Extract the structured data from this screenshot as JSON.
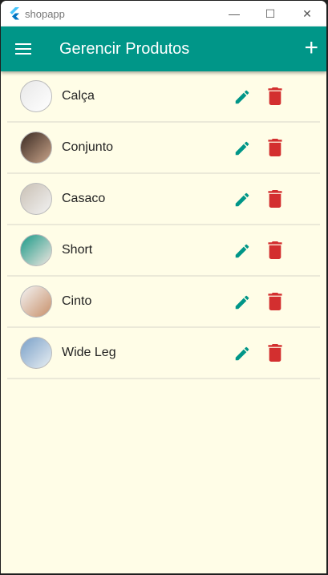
{
  "window": {
    "title": "shopapp",
    "minimize": "—",
    "maximize": "☐",
    "close": "✕"
  },
  "appbar": {
    "title": "Gerencir Produtos",
    "add": "+"
  },
  "colors": {
    "primary": "#009688",
    "danger": "#d32f2f",
    "background": "#fffde7"
  },
  "products": [
    {
      "name": "Calça",
      "avatar": [
        "#e8e8e8",
        "#ffffff"
      ]
    },
    {
      "name": "Conjunto",
      "avatar": [
        "#3a2a22",
        "#c9a48a"
      ]
    },
    {
      "name": "Casaco",
      "avatar": [
        "#c9c0b4",
        "#f2f2f2"
      ]
    },
    {
      "name": "Short",
      "avatar": [
        "#1a9a88",
        "#f0e6e0"
      ]
    },
    {
      "name": "Cinto",
      "avatar": [
        "#f3f3f3",
        "#c8906a"
      ]
    },
    {
      "name": "Wide Leg",
      "avatar": [
        "#7aa0c8",
        "#e8eef2"
      ]
    }
  ]
}
